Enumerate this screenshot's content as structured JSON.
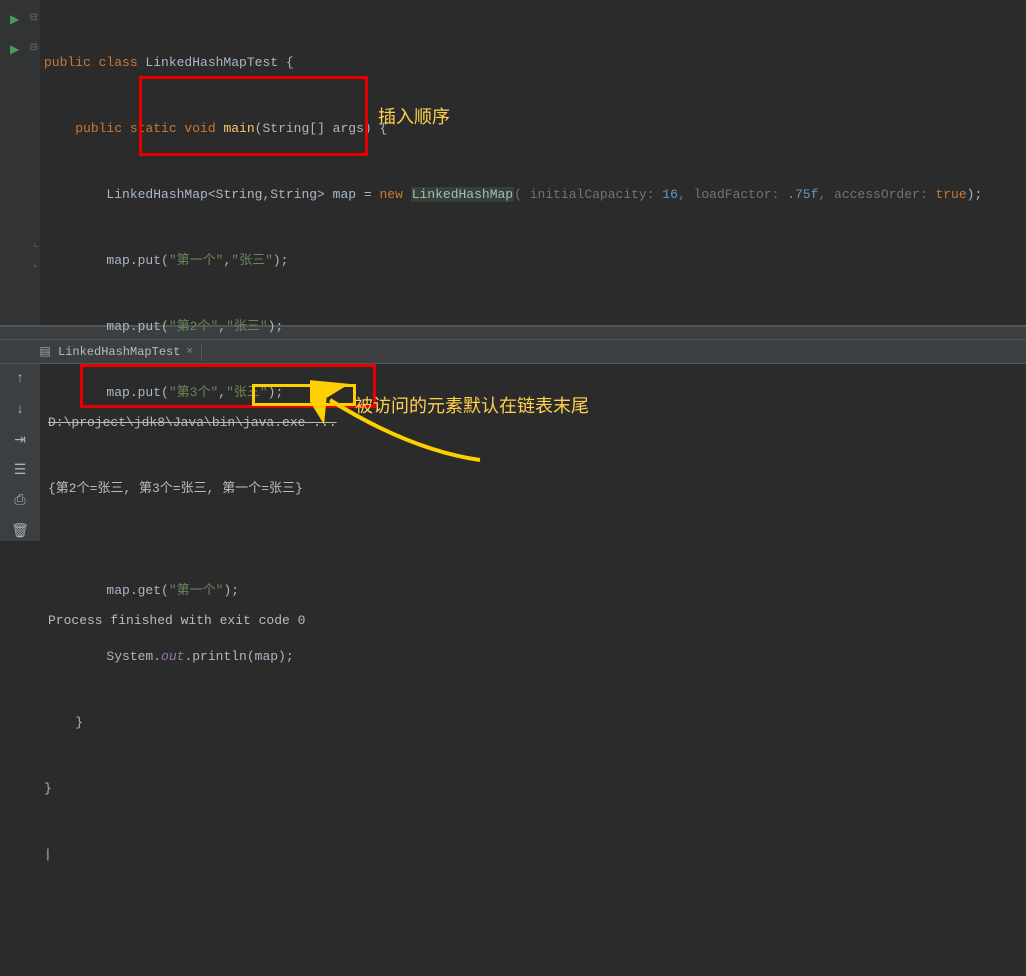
{
  "code": {
    "l1_kw1": "public class ",
    "l1_cls": "LinkedHashMapTest",
    "l1_brace": " {",
    "l2_kw": "public static void ",
    "l2_mth": "main",
    "l2_par": "(String[] args) {",
    "l3_a": "LinkedHashMap<String,String> map = ",
    "l3_new": "new ",
    "l3_ctor": "LinkedHashMap",
    "l3_p1": "( initialCapacity: ",
    "l3_v1": "16",
    "l3_c1": ", ",
    "l3_p2": "loadFactor: ",
    "l3_v2": ".75f",
    "l3_c2": ", ",
    "l3_p3": "accessOrder: ",
    "l3_v3": "true",
    "l3_end": ");",
    "l4": "map.put(",
    "l4s1": "\"第一个\"",
    "l4c": ",",
    "l4s2": "\"张三\"",
    "l4e": ");",
    "l5": "map.put(",
    "l5s1": "\"第2个\"",
    "l5c": ",",
    "l5s2": "\"张三\"",
    "l5e": ");",
    "l6": "map.put(",
    "l6s1": "\"第3个\"",
    "l6c": ",",
    "l6s2": "\"张三\"",
    "l6e": ");",
    "l8": "map.get(",
    "l8s": "\"第一个\"",
    "l8e": ");",
    "l9a": "System.",
    "l9fld": "out",
    "l9b": ".println(map);",
    "l10": "}",
    "l11": "}",
    "caret": "|",
    "annot_insert": "插入顺序"
  },
  "tab": {
    "label": "LinkedHashMapTest",
    "close": "×"
  },
  "console": {
    "cmd": "D:\\project\\jdk8\\Java\\bin\\java.exe ...",
    "out": "{第2个=张三, 第3个=张三, 第一个=张三}",
    "exit": "Process finished with exit code 0",
    "annot_tail": "被访问的元素默认在链表末尾"
  },
  "icons": {
    "play": "▶",
    "fold_minus": "⊟",
    "fold_end": "⌞",
    "window": "▤",
    "up": "↑",
    "down": "↓",
    "wrap": "⇥",
    "tree": "☰",
    "print": "⎙",
    "trash": "🗑"
  }
}
